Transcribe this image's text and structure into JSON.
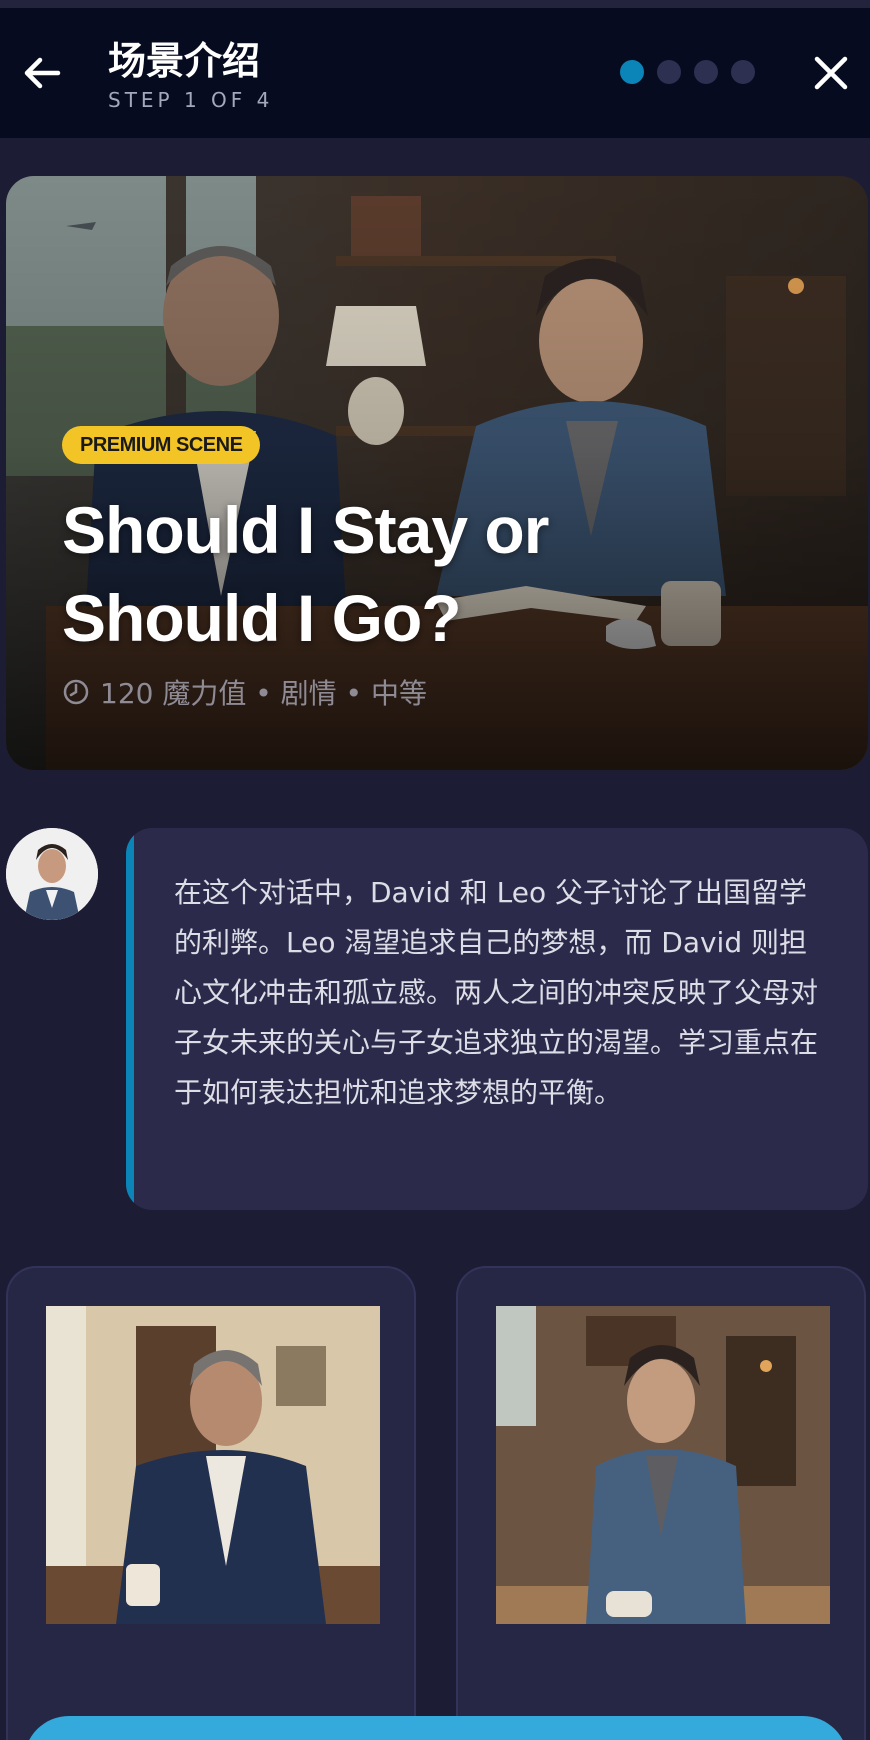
{
  "header": {
    "title": "场景介绍",
    "step": "STEP 1 OF 4",
    "total_steps": 4,
    "current_step": 1,
    "back_icon": "arrow-left-icon",
    "close_icon": "close-icon"
  },
  "hero": {
    "badge": "PREMIUM SCENE",
    "title": "Should I Stay or Should I Go?",
    "meta": "120 魔力值 • 剧情 • 中等",
    "meta_icon": "clock-icon"
  },
  "narration": {
    "text": "在这个对话中，David 和 Leo 父子讨论了出国留学的利弊。Leo 渴望追求自己的梦想，而 David 则担心文化冲击和孤立感。两人之间的冲突反映了父母对子女未来的关心与子女追求独立的渴望。学习重点在于如何表达担忧和追求梦想的平衡。"
  },
  "colors": {
    "background": "#1c1c34",
    "header": "#070b20",
    "accent": "#0b84b8",
    "badge": "#f3c425",
    "card": "#2b2a4b",
    "button": "#33a9dc"
  }
}
